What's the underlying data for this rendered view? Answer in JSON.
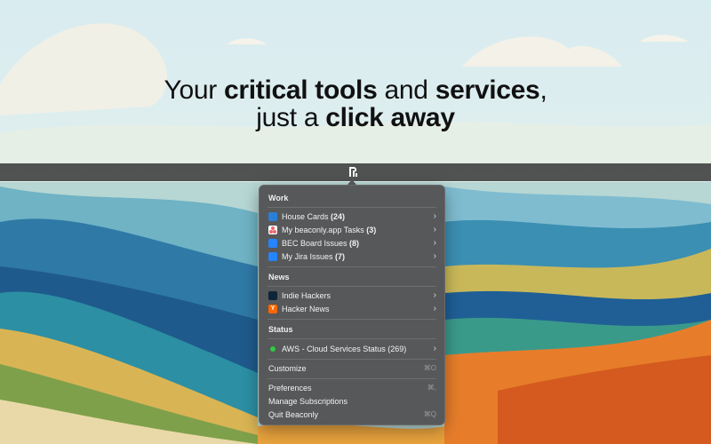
{
  "headline": {
    "line1_a": "Your ",
    "line1_b": "critical tools",
    "line1_c": " and ",
    "line1_d": "services",
    "line1_e": ",",
    "line2_a": "just a ",
    "line2_b": "click away"
  },
  "menu": {
    "sections": {
      "work": "Work",
      "news": "News",
      "status": "Status"
    },
    "work_items": [
      {
        "label": "House Cards ",
        "count": "(24)",
        "icon": "trello-icon"
      },
      {
        "label": "My beaconly.app Tasks ",
        "count": "(3)",
        "icon": "asana-icon"
      },
      {
        "label": "BEC Board Issues ",
        "count": "(8)",
        "icon": "jira-icon"
      },
      {
        "label": "My Jira Issues ",
        "count": "(7)",
        "icon": "jira-icon"
      }
    ],
    "news_items": [
      {
        "label": "Indie Hackers",
        "icon": "indie-hackers-icon"
      },
      {
        "label": "Hacker News",
        "icon": "hacker-news-icon",
        "glyph": "Y"
      }
    ],
    "status_items": [
      {
        "label": "AWS - Cloud Services Status (269)",
        "icon": "status-dot-icon"
      }
    ],
    "customize": {
      "label": "Customize",
      "shortcut": "⌘O"
    },
    "preferences": {
      "label": "Preferences",
      "shortcut": "⌘,"
    },
    "manage": {
      "label": "Manage Subscriptions"
    },
    "quit": {
      "label": "Quit Beaconly",
      "shortcut": "⌘Q"
    },
    "chevron": "›"
  },
  "colors": {
    "menu_bg": "#525254",
    "status_ok": "#2ecc40",
    "hacker_news": "#ff6600"
  }
}
